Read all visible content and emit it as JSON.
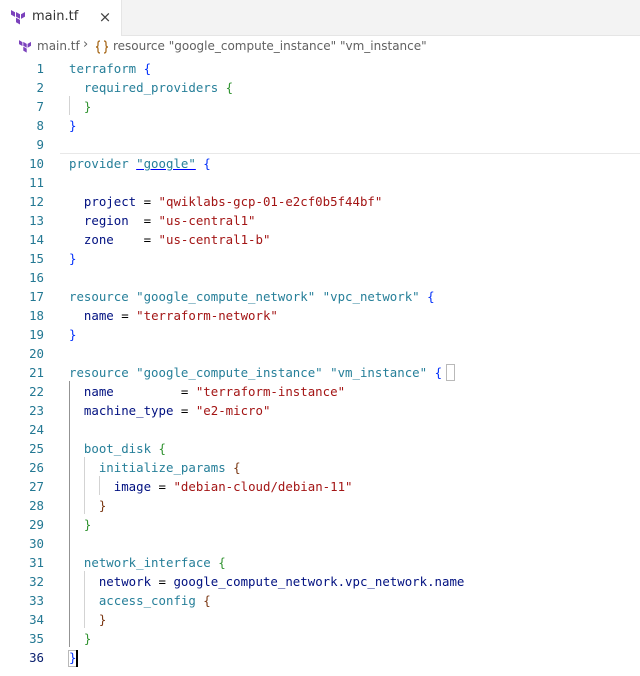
{
  "tab": {
    "label": "main.tf",
    "close": "×"
  },
  "breadcrumb": {
    "file": "main.tf",
    "separator": "›",
    "symbol": "resource \"google_compute_instance\" \"vm_instance\""
  },
  "editor": {
    "line_numbers": [
      "1",
      "2",
      "7",
      "8",
      "9",
      "10",
      "11",
      "12",
      "13",
      "14",
      "15",
      "16",
      "17",
      "18",
      "19",
      "20",
      "21",
      "22",
      "23",
      "24",
      "25",
      "26",
      "27",
      "28",
      "29",
      "30",
      "31",
      "32",
      "33",
      "34",
      "35",
      "36"
    ],
    "active_line": "36",
    "lines": [
      {
        "n": "1",
        "tokens": [
          {
            "t": "terraform ",
            "c": "blk"
          },
          {
            "t": "{",
            "c": "b1"
          }
        ]
      },
      {
        "n": "2",
        "tokens": [
          {
            "t": "  "
          },
          {
            "t": "required_providers ",
            "c": "blk"
          },
          {
            "t": "{",
            "c": "b2"
          }
        ]
      },
      {
        "n": "7",
        "tokens": [
          {
            "t": "  "
          },
          {
            "t": "}",
            "c": "b2"
          }
        ]
      },
      {
        "n": "8",
        "tokens": [
          {
            "t": "}",
            "c": "b1"
          }
        ]
      },
      {
        "n": "9",
        "tokens": []
      },
      {
        "n": "10",
        "tokens": [
          {
            "t": "provider ",
            "c": "blk"
          },
          {
            "t": "\"google\"",
            "c": "kw link"
          },
          {
            "t": " "
          },
          {
            "t": "{",
            "c": "b1"
          }
        ]
      },
      {
        "n": "11",
        "tokens": []
      },
      {
        "n": "12",
        "tokens": [
          {
            "t": "  "
          },
          {
            "t": "project",
            "c": "prop"
          },
          {
            "t": " = "
          },
          {
            "t": "\"qwiklabs-gcp-01-e2cf0b5f44bf\"",
            "c": "str"
          }
        ]
      },
      {
        "n": "13",
        "tokens": [
          {
            "t": "  "
          },
          {
            "t": "region",
            "c": "prop"
          },
          {
            "t": "  = "
          },
          {
            "t": "\"us-central1\"",
            "c": "str"
          }
        ]
      },
      {
        "n": "14",
        "tokens": [
          {
            "t": "  "
          },
          {
            "t": "zone",
            "c": "prop"
          },
          {
            "t": "    = "
          },
          {
            "t": "\"us-central1-b\"",
            "c": "str"
          }
        ]
      },
      {
        "n": "15",
        "tokens": [
          {
            "t": "}",
            "c": "b1"
          }
        ]
      },
      {
        "n": "16",
        "tokens": []
      },
      {
        "n": "17",
        "tokens": [
          {
            "t": "resource ",
            "c": "blk"
          },
          {
            "t": "\"google_compute_network\"",
            "c": "kw"
          },
          {
            "t": " "
          },
          {
            "t": "\"vpc_network\"",
            "c": "kw"
          },
          {
            "t": " "
          },
          {
            "t": "{",
            "c": "b1"
          }
        ]
      },
      {
        "n": "18",
        "tokens": [
          {
            "t": "  "
          },
          {
            "t": "name",
            "c": "prop"
          },
          {
            "t": " = "
          },
          {
            "t": "\"terraform-network\"",
            "c": "str"
          }
        ]
      },
      {
        "n": "19",
        "tokens": [
          {
            "t": "}",
            "c": "b1"
          }
        ]
      },
      {
        "n": "20",
        "tokens": []
      },
      {
        "n": "21",
        "tokens": [
          {
            "t": "resource ",
            "c": "blk"
          },
          {
            "t": "\"google_compute_instance\"",
            "c": "kw"
          },
          {
            "t": " "
          },
          {
            "t": "\"vm_instance\"",
            "c": "kw"
          },
          {
            "t": " "
          },
          {
            "t": "{",
            "c": "b1"
          }
        ]
      },
      {
        "n": "22",
        "tokens": [
          {
            "t": "  "
          },
          {
            "t": "name",
            "c": "prop"
          },
          {
            "t": "         = "
          },
          {
            "t": "\"terraform-instance\"",
            "c": "str"
          }
        ]
      },
      {
        "n": "23",
        "tokens": [
          {
            "t": "  "
          },
          {
            "t": "machine_type",
            "c": "prop"
          },
          {
            "t": " = "
          },
          {
            "t": "\"e2-micro\"",
            "c": "str"
          }
        ]
      },
      {
        "n": "24",
        "tokens": []
      },
      {
        "n": "25",
        "tokens": [
          {
            "t": "  "
          },
          {
            "t": "boot_disk ",
            "c": "blk"
          },
          {
            "t": "{",
            "c": "b2"
          }
        ]
      },
      {
        "n": "26",
        "tokens": [
          {
            "t": "    "
          },
          {
            "t": "initialize_params ",
            "c": "blk"
          },
          {
            "t": "{",
            "c": "b3"
          }
        ]
      },
      {
        "n": "27",
        "tokens": [
          {
            "t": "      "
          },
          {
            "t": "image",
            "c": "prop"
          },
          {
            "t": " = "
          },
          {
            "t": "\"debian-cloud/debian-11\"",
            "c": "str"
          }
        ]
      },
      {
        "n": "28",
        "tokens": [
          {
            "t": "    "
          },
          {
            "t": "}",
            "c": "b3"
          }
        ]
      },
      {
        "n": "29",
        "tokens": [
          {
            "t": "  "
          },
          {
            "t": "}",
            "c": "b2"
          }
        ]
      },
      {
        "n": "30",
        "tokens": []
      },
      {
        "n": "31",
        "tokens": [
          {
            "t": "  "
          },
          {
            "t": "network_interface ",
            "c": "blk"
          },
          {
            "t": "{",
            "c": "b2"
          }
        ]
      },
      {
        "n": "32",
        "tokens": [
          {
            "t": "    "
          },
          {
            "t": "network",
            "c": "prop"
          },
          {
            "t": " = "
          },
          {
            "t": "google_compute_network.vpc_network.name",
            "c": "prop"
          }
        ]
      },
      {
        "n": "33",
        "tokens": [
          {
            "t": "    "
          },
          {
            "t": "access_config ",
            "c": "blk"
          },
          {
            "t": "{",
            "c": "b3"
          }
        ]
      },
      {
        "n": "34",
        "tokens": [
          {
            "t": "    "
          },
          {
            "t": "}",
            "c": "b3"
          }
        ]
      },
      {
        "n": "35",
        "tokens": [
          {
            "t": "  "
          },
          {
            "t": "}",
            "c": "b2"
          }
        ]
      },
      {
        "n": "36",
        "tokens": [
          {
            "t": "}",
            "c": "b1"
          }
        ]
      }
    ]
  },
  "colors": {
    "terraform_brand": "#7b42bc",
    "line_number": "#237893",
    "string": "#a31515",
    "block_keyword": "#267f99",
    "property": "#001080"
  }
}
